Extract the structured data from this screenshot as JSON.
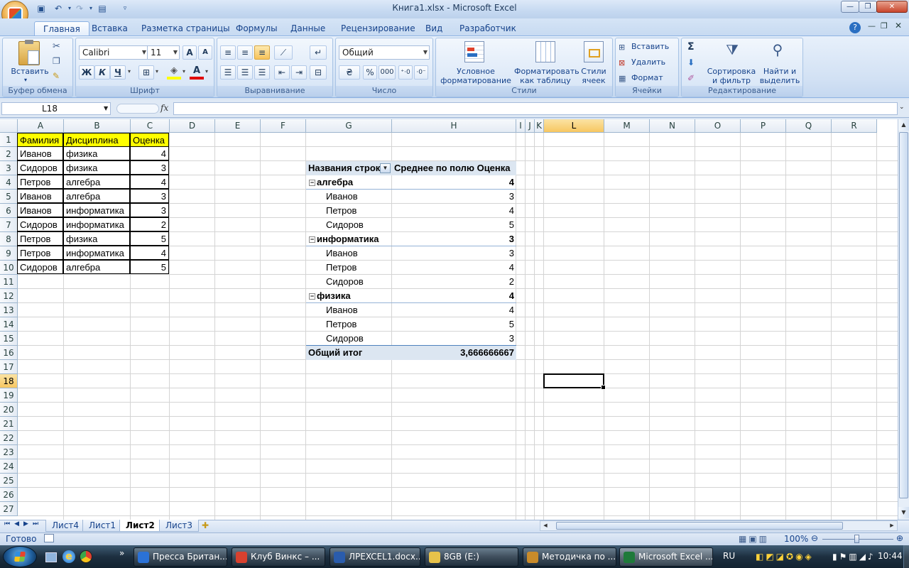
{
  "window": {
    "title": "Книга1.xlsx - Microsoft Excel"
  },
  "ribbon": {
    "tabs": [
      "Главная",
      "Вставка",
      "Разметка страницы",
      "Формулы",
      "Данные",
      "Рецензирование",
      "Вид",
      "Разработчик"
    ],
    "groups": {
      "clipboard": {
        "label": "Буфер обмена",
        "paste": "Вставить"
      },
      "font": {
        "label": "Шрифт",
        "name": "Calibri",
        "size": "11",
        "bold": "Ж",
        "italic": "К",
        "underline": "Ч",
        "grow": "A",
        "shrink": "A",
        "color_letter": "A"
      },
      "alignment": {
        "label": "Выравнивание"
      },
      "number": {
        "label": "Число",
        "format": "Общий",
        "percent": "%",
        "thousands": "000"
      },
      "styles": {
        "label": "Стили",
        "cond_1": "Условное",
        "cond_2": "форматирование",
        "table_1": "Форматировать",
        "table_2": "как таблицу",
        "cell_1": "Стили",
        "cell_2": "ячеек"
      },
      "cells": {
        "label": "Ячейки",
        "insert": "Вставить",
        "delete": "Удалить",
        "format": "Формат"
      },
      "editing": {
        "label": "Редактирование",
        "sort_1": "Сортировка",
        "sort_2": "и фильтр",
        "find_1": "Найти и",
        "find_2": "выделить",
        "sigma": "Σ"
      }
    }
  },
  "formula_bar": {
    "name_box": "L18",
    "fx": "fx",
    "value": ""
  },
  "grid": {
    "columns": [
      {
        "name": "A"
      },
      {
        "name": "B"
      },
      {
        "name": "C"
      },
      {
        "name": "D"
      },
      {
        "name": "E"
      },
      {
        "name": "F"
      },
      {
        "name": "G"
      },
      {
        "name": "H"
      },
      {
        "name": "I"
      },
      {
        "name": "J"
      },
      {
        "name": "K"
      },
      {
        "name": "L"
      },
      {
        "name": "M"
      },
      {
        "name": "N"
      },
      {
        "name": "O"
      },
      {
        "name": "P"
      },
      {
        "name": "Q"
      },
      {
        "name": "R"
      }
    ],
    "rows": [
      "1",
      "2",
      "3",
      "4",
      "5",
      "6",
      "7",
      "8",
      "9",
      "10",
      "11",
      "12",
      "13",
      "14",
      "15",
      "16",
      "17",
      "18",
      "19",
      "20",
      "21",
      "22",
      "23",
      "24",
      "25",
      "26",
      "27"
    ],
    "selected_cell": "L18",
    "source_table": {
      "headers": [
        "Фамилия",
        "Дисциплина",
        "Оценка"
      ],
      "rows": [
        [
          "Иванов",
          "физика",
          "4"
        ],
        [
          "Сидоров",
          "физика",
          "3"
        ],
        [
          "Петров",
          "алгебра",
          "4"
        ],
        [
          "Иванов",
          "алгебра",
          "3"
        ],
        [
          "Иванов",
          "информатика",
          "3"
        ],
        [
          "Сидоров",
          "информатика",
          "2"
        ],
        [
          "Петров",
          "физика",
          "5"
        ],
        [
          "Петров",
          "информатика",
          "4"
        ],
        [
          "Сидоров",
          "алгебра",
          "5"
        ]
      ]
    },
    "pivot": {
      "row_label_header": "Названия строк",
      "value_header": "Среднее по полю Оценка",
      "groups": [
        {
          "name": "алгебра",
          "value": "4",
          "items": [
            [
              "Иванов",
              "3"
            ],
            [
              "Петров",
              "4"
            ],
            [
              "Сидоров",
              "5"
            ]
          ]
        },
        {
          "name": "информатика",
          "value": "3",
          "items": [
            [
              "Иванов",
              "3"
            ],
            [
              "Петров",
              "4"
            ],
            [
              "Сидоров",
              "2"
            ]
          ]
        },
        {
          "name": "физика",
          "value": "4",
          "items": [
            [
              "Иванов",
              "4"
            ],
            [
              "Петров",
              "5"
            ],
            [
              "Сидоров",
              "3"
            ]
          ]
        }
      ],
      "total_label": "Общий итог",
      "total_value": "3,666666667"
    }
  },
  "sheets": {
    "tabs": [
      "Лист4",
      "Лист1",
      "Лист2",
      "Лист3"
    ],
    "active": "Лист2"
  },
  "status": {
    "ready": "Готово",
    "zoom": "100%"
  },
  "taskbar": {
    "items": [
      {
        "label": "Пресса Британ...",
        "color": "#2b72d7"
      },
      {
        "label": "Клуб Винкс – ...",
        "color": "#d8412f"
      },
      {
        "label": "ЛРEXCEL1.docx...",
        "color": "#2a5cac"
      },
      {
        "label": "8GB (E:)",
        "color": "#e7c24a"
      },
      {
        "label": "Методичка по ...",
        "color": "#c98b2a"
      },
      {
        "label": "Microsoft Excel ...",
        "color": "#1f7a3a"
      }
    ],
    "lang": "RU",
    "clock": "10:44"
  }
}
